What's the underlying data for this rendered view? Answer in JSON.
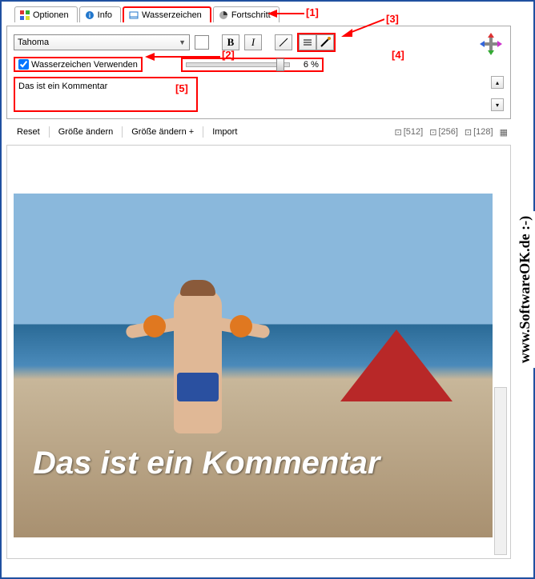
{
  "tabs": {
    "optionen": "Optionen",
    "info": "Info",
    "wasserzeichen": "Wasserzeichen",
    "fortschritt": "Fortschritt"
  },
  "font_panel": {
    "font_name": "Tahoma",
    "bold": "B",
    "italic": "I",
    "checkbox_label": "Wasserzeichen Verwenden",
    "slider_value": "6 %",
    "comment_text": "Das ist ein Kommentar"
  },
  "annotations": {
    "a1": "[1]",
    "a2": "[2]",
    "a3": "[3]",
    "a4": "[4]",
    "a5": "[5]"
  },
  "toolbar2": {
    "reset": "Reset",
    "groesse_aendern": "Größe ändern",
    "groesse_aendern_plus": "Größe ändern +",
    "import": "Import",
    "size512": "[512]",
    "size256": "[256]",
    "size128": "[128]"
  },
  "preview": {
    "watermark": "Das ist ein Kommentar"
  },
  "side_text": "www.SoftwareOK.de :-)"
}
